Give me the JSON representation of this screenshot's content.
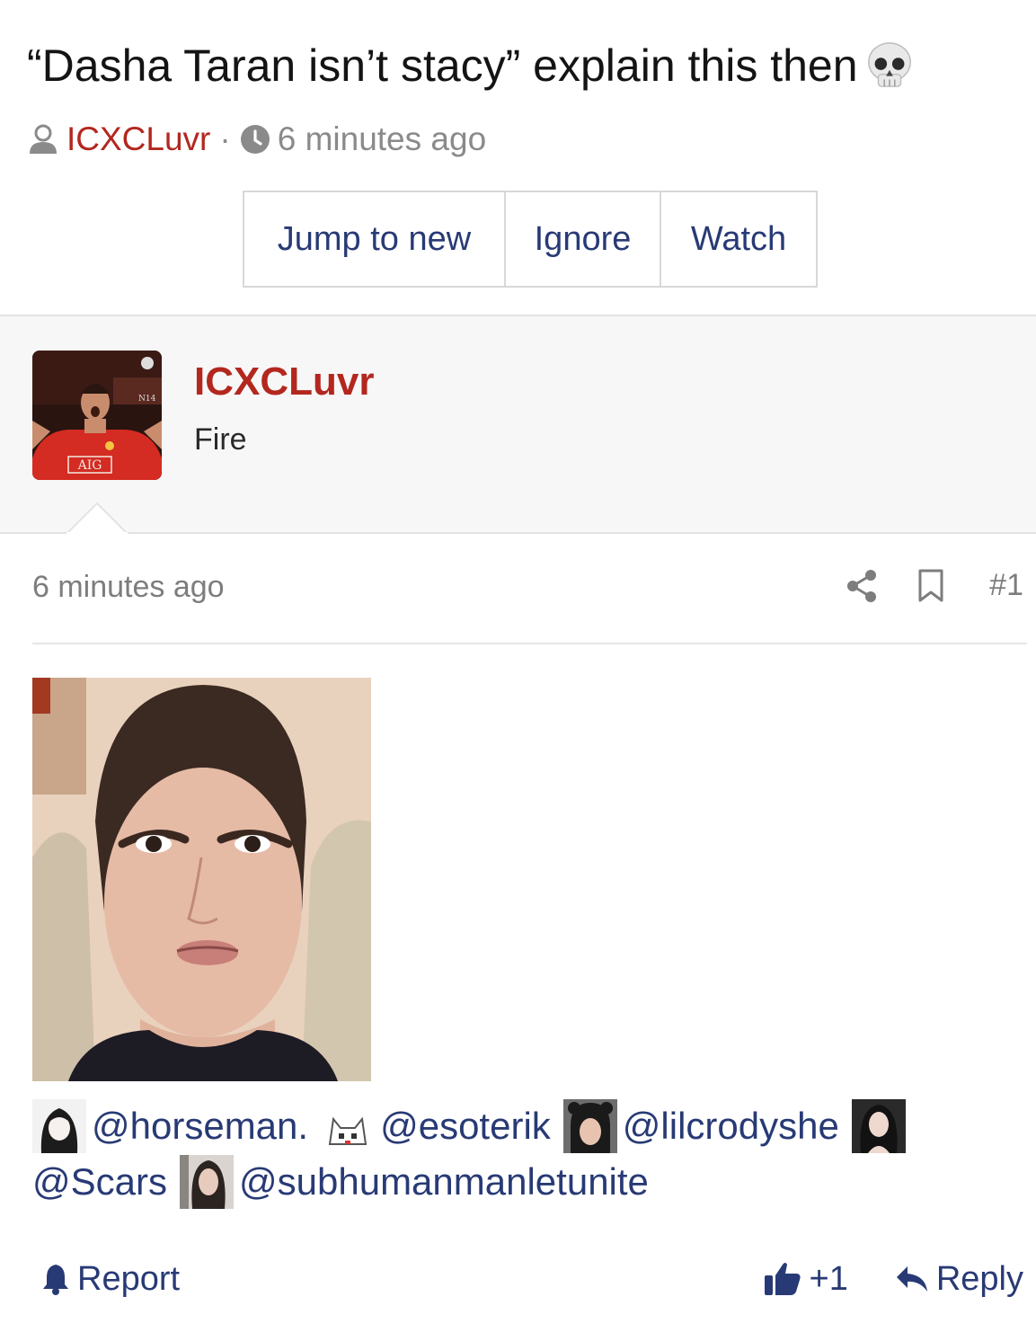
{
  "thread": {
    "title": "“Dasha Taran isn’t stacy” explain this then",
    "title_emoji": "skull-emoji",
    "author": "ICXCLuvr",
    "separator": "·",
    "time": "6 minutes ago"
  },
  "actions": {
    "jump_to_new": "Jump to new",
    "ignore": "Ignore",
    "watch": "Watch"
  },
  "post": {
    "author": "ICXCLuvr",
    "user_title": "Fire",
    "avatar_jersey_text": "AIG",
    "time": "6 minutes ago",
    "number": "#1",
    "mentions": [
      {
        "name": "@horseman."
      },
      {
        "name": "@esoterik"
      },
      {
        "name": "@lilcrodyshe"
      },
      {
        "name": "@Scars"
      },
      {
        "name": "@subhumanmanletunite"
      }
    ]
  },
  "footer": {
    "report": "Report",
    "like_count": "+1",
    "reply": "Reply"
  },
  "colors": {
    "accent_red": "#b3271f",
    "link_navy": "#283a75",
    "muted_gray": "#7d7d7d",
    "op_background": "#f7f7f7"
  },
  "icons": [
    "user-icon",
    "clock-icon",
    "share-icon",
    "bookmark-icon",
    "bell-icon",
    "thumbs-up-icon",
    "reply-icon"
  ]
}
